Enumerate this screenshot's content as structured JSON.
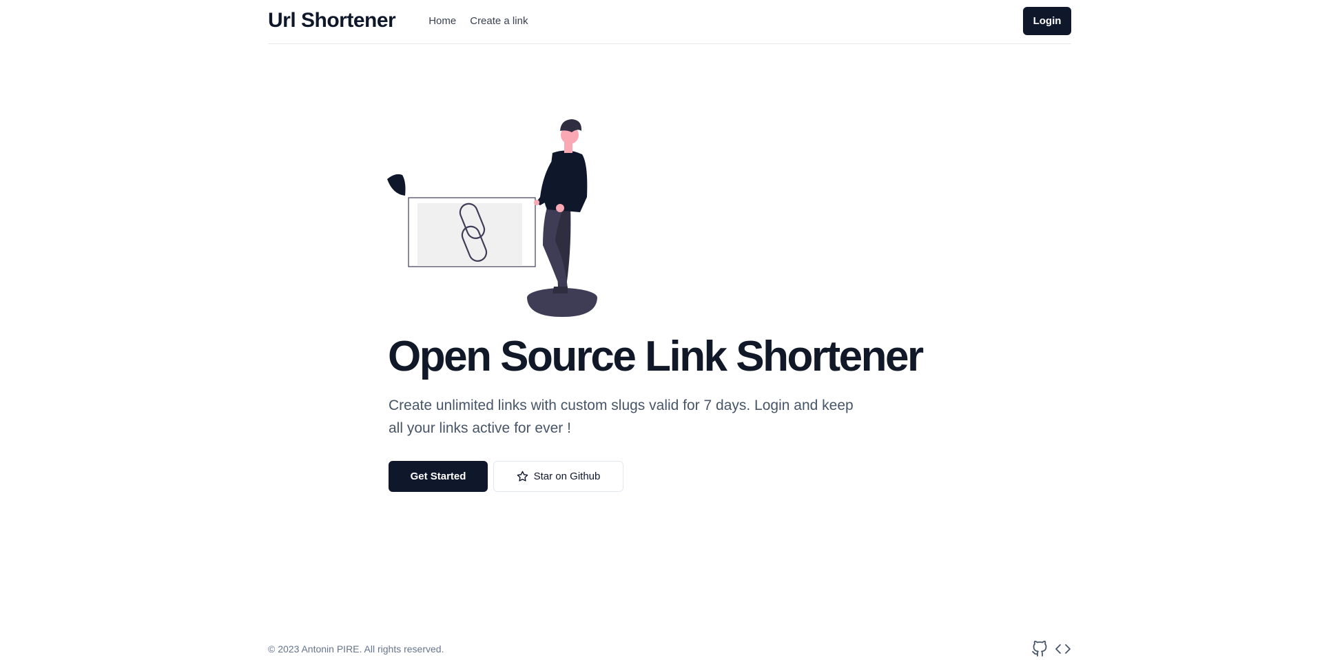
{
  "header": {
    "brand": "Url Shortener",
    "nav": [
      {
        "label": "Home"
      },
      {
        "label": "Create a link"
      }
    ],
    "login_label": "Login"
  },
  "hero": {
    "illustration": "person-holding-link-card",
    "title": "Open Source Link Shortener",
    "description": "Create unlimited links with custom slugs valid for 7 days. Login and keep all your links active for ever !",
    "get_started_label": "Get Started",
    "star_label": "Star on Github",
    "star_icon": "star-icon"
  },
  "footer": {
    "copyright": "© 2023 Antonin PIRE. All rights reserved.",
    "icons": [
      "github-icon",
      "code-icon"
    ]
  },
  "colors": {
    "primary": "#0f172a",
    "text_muted": "#64748b",
    "border": "#e5e7eb"
  }
}
